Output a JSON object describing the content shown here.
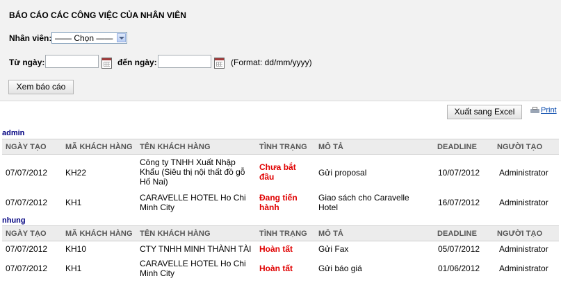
{
  "page_title": "BÁO CÁO CÁC CÔNG VIỆC CỦA NHÂN VIÊN",
  "filters": {
    "employee_label": "Nhân viên:",
    "employee_selected": "—— Chọn ——",
    "from_label": "Từ ngày:",
    "from_value": "",
    "to_label": "đến ngày:",
    "to_value": "",
    "format_hint": "(Format: dd/mm/yyyy)",
    "view_button": "Xem báo cáo"
  },
  "toolbar": {
    "export_button": "Xuất sang Excel",
    "print_link": "Print"
  },
  "columns": [
    "NGÀY TẠO",
    "MÃ KHÁCH HÀNG",
    "TÊN KHÁCH HÀNG",
    "TÌNH TRẠNG",
    "MÔ TẢ",
    "DEADLINE",
    "NGƯỜI TẠO"
  ],
  "groups": [
    {
      "name": "admin",
      "rows": [
        {
          "date": "07/07/2012",
          "code": "KH22",
          "customer": "Công ty TNHH Xuất Nhập Khẩu (Siêu thị nội thất đồ gỗ Hố Nai)",
          "status": "Chưa bắt đầu",
          "desc": "Gửi proposal",
          "deadline": "10/07/2012",
          "creator": "Administrator"
        },
        {
          "date": "07/07/2012",
          "code": "KH1",
          "customer": "CARAVELLE HOTEL Ho Chi Minh City",
          "status": "Đang tiến hành",
          "desc": "Giao sách cho Caravelle Hotel",
          "deadline": "16/07/2012",
          "creator": "Administrator"
        }
      ]
    },
    {
      "name": "nhung",
      "rows": [
        {
          "date": "07/07/2012",
          "code": "KH10",
          "customer": "CTY TNHH MINH THÀNH TÀI",
          "status": "Hoàn tất",
          "desc": "Gửi Fax",
          "deadline": "05/07/2012",
          "creator": "Administrator"
        },
        {
          "date": "07/07/2012",
          "code": "KH1",
          "customer": "CARAVELLE HOTEL Ho Chi Minh City",
          "status": "Hoàn tất",
          "desc": "Gửi báo giá",
          "deadline": "01/06/2012",
          "creator": "Administrator"
        }
      ]
    }
  ],
  "colors": {
    "status": "#e00000",
    "group_label": "#000080",
    "header_bg": "#ececec"
  }
}
